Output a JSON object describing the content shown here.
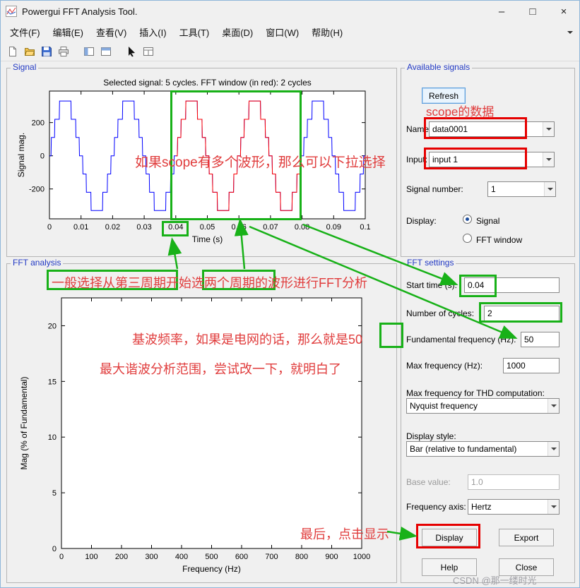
{
  "window": {
    "title": "Powergui FFT Analysis Tool.",
    "minimize_glyph": "–",
    "maximize_glyph": "□",
    "close_glyph": "×"
  },
  "menu": {
    "items": [
      "文件(F)",
      "编辑(E)",
      "查看(V)",
      "插入(I)",
      "工具(T)",
      "桌面(D)",
      "窗口(W)",
      "帮助(H)"
    ]
  },
  "toolbar": {
    "icons": [
      "new-document",
      "open-folder",
      "save",
      "print",
      "plot-tools-left",
      "plot-tools-top",
      "arrow-cursor",
      "window-layout"
    ]
  },
  "panels": {
    "signal_title": "Signal",
    "available_title": "Available signals",
    "fft_analysis_title": "FFT analysis",
    "fft_settings_title": "FFT settings"
  },
  "available_signals": {
    "refresh": "Refresh",
    "name_label": "Name:",
    "name_value": "data0001",
    "input_label": "Input:",
    "input_value": "input 1",
    "signal_number_label": "Signal number:",
    "signal_number_value": "1",
    "display_label": "Display:",
    "radio_signal": "Signal",
    "radio_fft_window": "FFT window"
  },
  "fft_settings": {
    "start_time_label": "Start time (s):",
    "start_time_value": "0.04",
    "cycles_label": "Number of cycles:",
    "cycles_value": "2",
    "fundamental_label": "Fundamental frequency (Hz):",
    "fundamental_value": "50",
    "max_freq_label": "Max frequency (Hz):",
    "max_freq_value": "1000",
    "thd_label": "Max frequency for THD computation:",
    "thd_value": "Nyquist frequency",
    "display_style_label": "Display style:",
    "display_style_value": "Bar (relative to fundamental)",
    "base_value_label": "Base value:",
    "base_value_value": "1.0",
    "freq_axis_label": "Frequency axis:",
    "freq_axis_value": "Hertz",
    "display_button": "Display",
    "export_button": "Export",
    "help_button": "Help",
    "close_button": "Close"
  },
  "annotations": {
    "scope_data": "scope的数据",
    "multi_waveform": "如果scope有多个波形，那么可以下拉选择",
    "cycle_selection": "一般选择从第三周期开始选两个周期的波形进行FFT分析",
    "fundamental_freq": "基波频率，如果是电网的话，那么就是50",
    "max_harmonic": "最大谐波分析范围，尝试改一下，就明白了",
    "click_display": "最后，点击显示",
    "watermark": "CSDN @那一缕时光",
    "highlight_color_green": "#18b118",
    "highlight_color_red": "#e60000",
    "annotation_text_color": "#e03c3c"
  },
  "chart_data": [
    {
      "type": "line",
      "title": "Selected signal: 5 cycles. FFT window (in red): 2 cycles",
      "xlabel": "Time (s)",
      "ylabel": "Signal mag.",
      "xlim": [
        0,
        0.1
      ],
      "ylim": [
        -380,
        390
      ],
      "xticks": [
        0,
        0.01,
        0.02,
        0.03,
        0.04,
        0.05,
        0.06,
        0.07,
        0.08,
        0.09,
        0.1
      ],
      "yticks": [
        -200,
        0,
        200
      ],
      "grid": false,
      "series": [
        {
          "name": "selected-signal",
          "color": "#0000ff",
          "waveform": "staircase-sine",
          "frequency_hz": 50,
          "amplitude": 330,
          "levels": 3,
          "t_range": [
            0,
            0.1
          ]
        },
        {
          "name": "fft-window",
          "color": "#ff0000",
          "waveform": "staircase-sine",
          "frequency_hz": 50,
          "amplitude": 330,
          "levels": 3,
          "t_range": [
            0.04,
            0.08
          ]
        }
      ]
    },
    {
      "type": "bar",
      "title": "",
      "xlabel": "Frequency (Hz)",
      "ylabel": "Mag (% of Fundamental)",
      "xlim": [
        0,
        1000
      ],
      "ylim": [
        0,
        22.5
      ],
      "xticks": [
        0,
        100,
        200,
        300,
        400,
        500,
        600,
        700,
        800,
        900,
        1000
      ],
      "yticks": [
        0,
        5,
        10,
        15,
        20
      ],
      "grid": false,
      "values": []
    }
  ]
}
